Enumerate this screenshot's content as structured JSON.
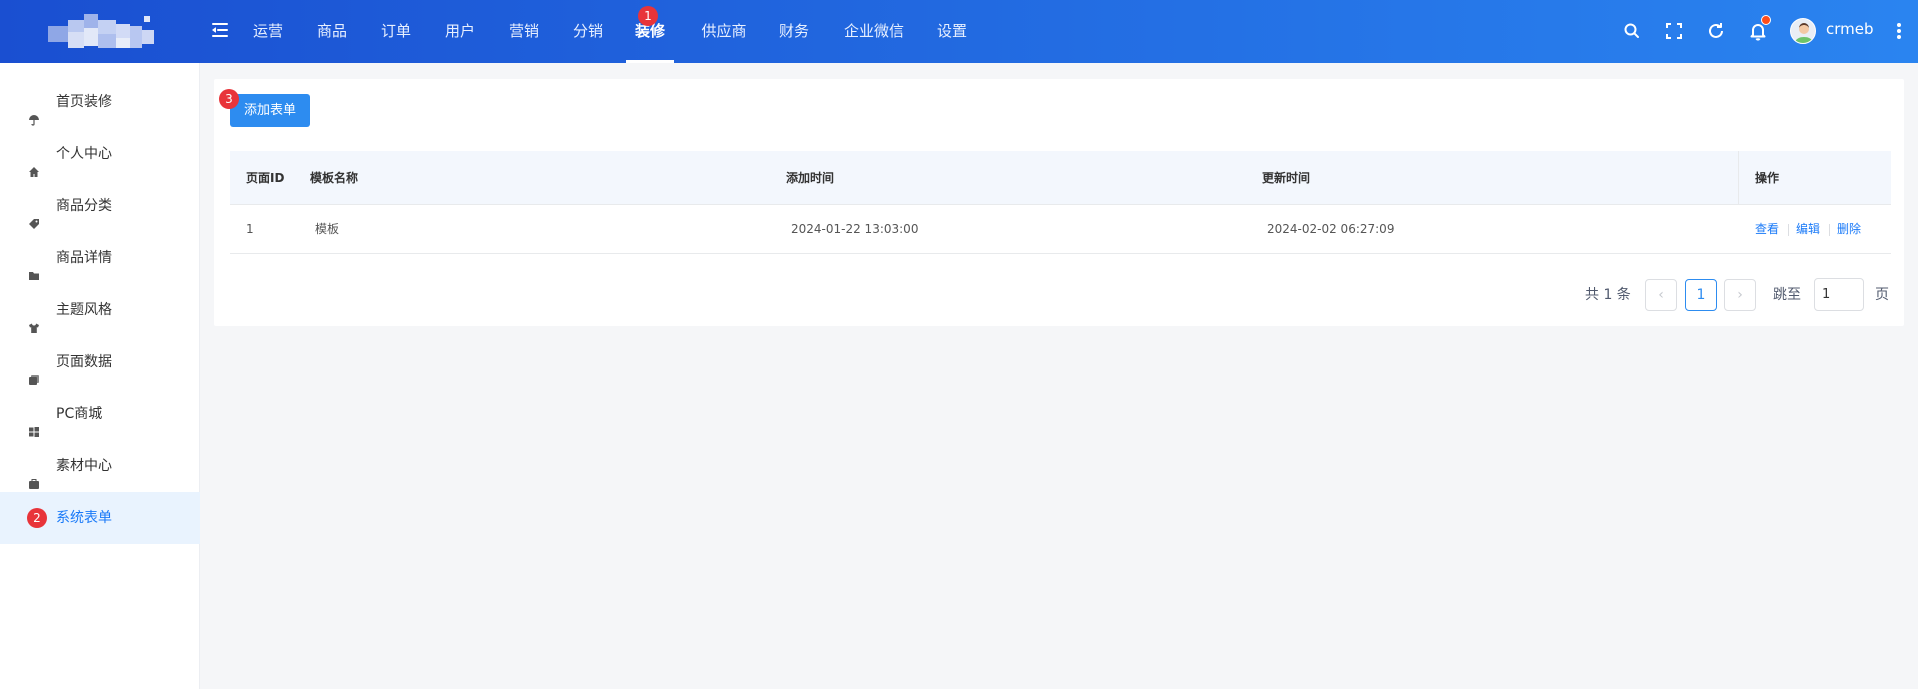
{
  "header": {
    "nav": [
      {
        "label": "运营"
      },
      {
        "label": "商品"
      },
      {
        "label": "订单"
      },
      {
        "label": "用户"
      },
      {
        "label": "营销"
      },
      {
        "label": "分销"
      },
      {
        "label": "装修",
        "active": true,
        "badge": "1"
      },
      {
        "label": "供应商"
      },
      {
        "label": "财务"
      },
      {
        "label": "企业微信"
      },
      {
        "label": "设置"
      }
    ],
    "username": "crmeb",
    "icons": [
      "search-icon",
      "fullscreen-icon",
      "refresh-icon",
      "bell-icon",
      "more-icon"
    ],
    "notification_dot_color": "#ff4d1a"
  },
  "sidebar": {
    "items": [
      {
        "label": "首页装修",
        "icon": "umbrella-icon"
      },
      {
        "label": "个人中心",
        "icon": "home-icon"
      },
      {
        "label": "商品分类",
        "icon": "tag-icon"
      },
      {
        "label": "商品详情",
        "icon": "folder-icon"
      },
      {
        "label": "主题风格",
        "icon": "shirt-icon"
      },
      {
        "label": "页面数据",
        "icon": "layers-icon"
      },
      {
        "label": "PC商城",
        "icon": "windows-icon"
      },
      {
        "label": "素材中心",
        "icon": "briefcase-icon"
      },
      {
        "label": "系统表单",
        "icon": "",
        "active": true,
        "badge": "2"
      }
    ]
  },
  "main": {
    "add_button": {
      "label": "添加表单",
      "badge": "3"
    },
    "table": {
      "columns": [
        "页面ID",
        "模板名称",
        "添加时间",
        "更新时间",
        "操作"
      ],
      "rows": [
        {
          "id": "1",
          "name": "模板",
          "created": "2024-01-22 13:03:00",
          "updated": "2024-02-02 06:27:09"
        }
      ],
      "actions": [
        "查看",
        "编辑",
        "删除"
      ]
    },
    "pagination": {
      "total_text": "共 1 条",
      "current_page": "1",
      "jump_label": "跳至",
      "jump_value": "1",
      "page_label": "页"
    }
  },
  "colors": {
    "header_gradient_start": "#1a4fd1",
    "header_gradient_end": "#2a84f0",
    "primary": "#2d8cf0",
    "badge": "#e8343a",
    "link": "#1a7af8"
  }
}
